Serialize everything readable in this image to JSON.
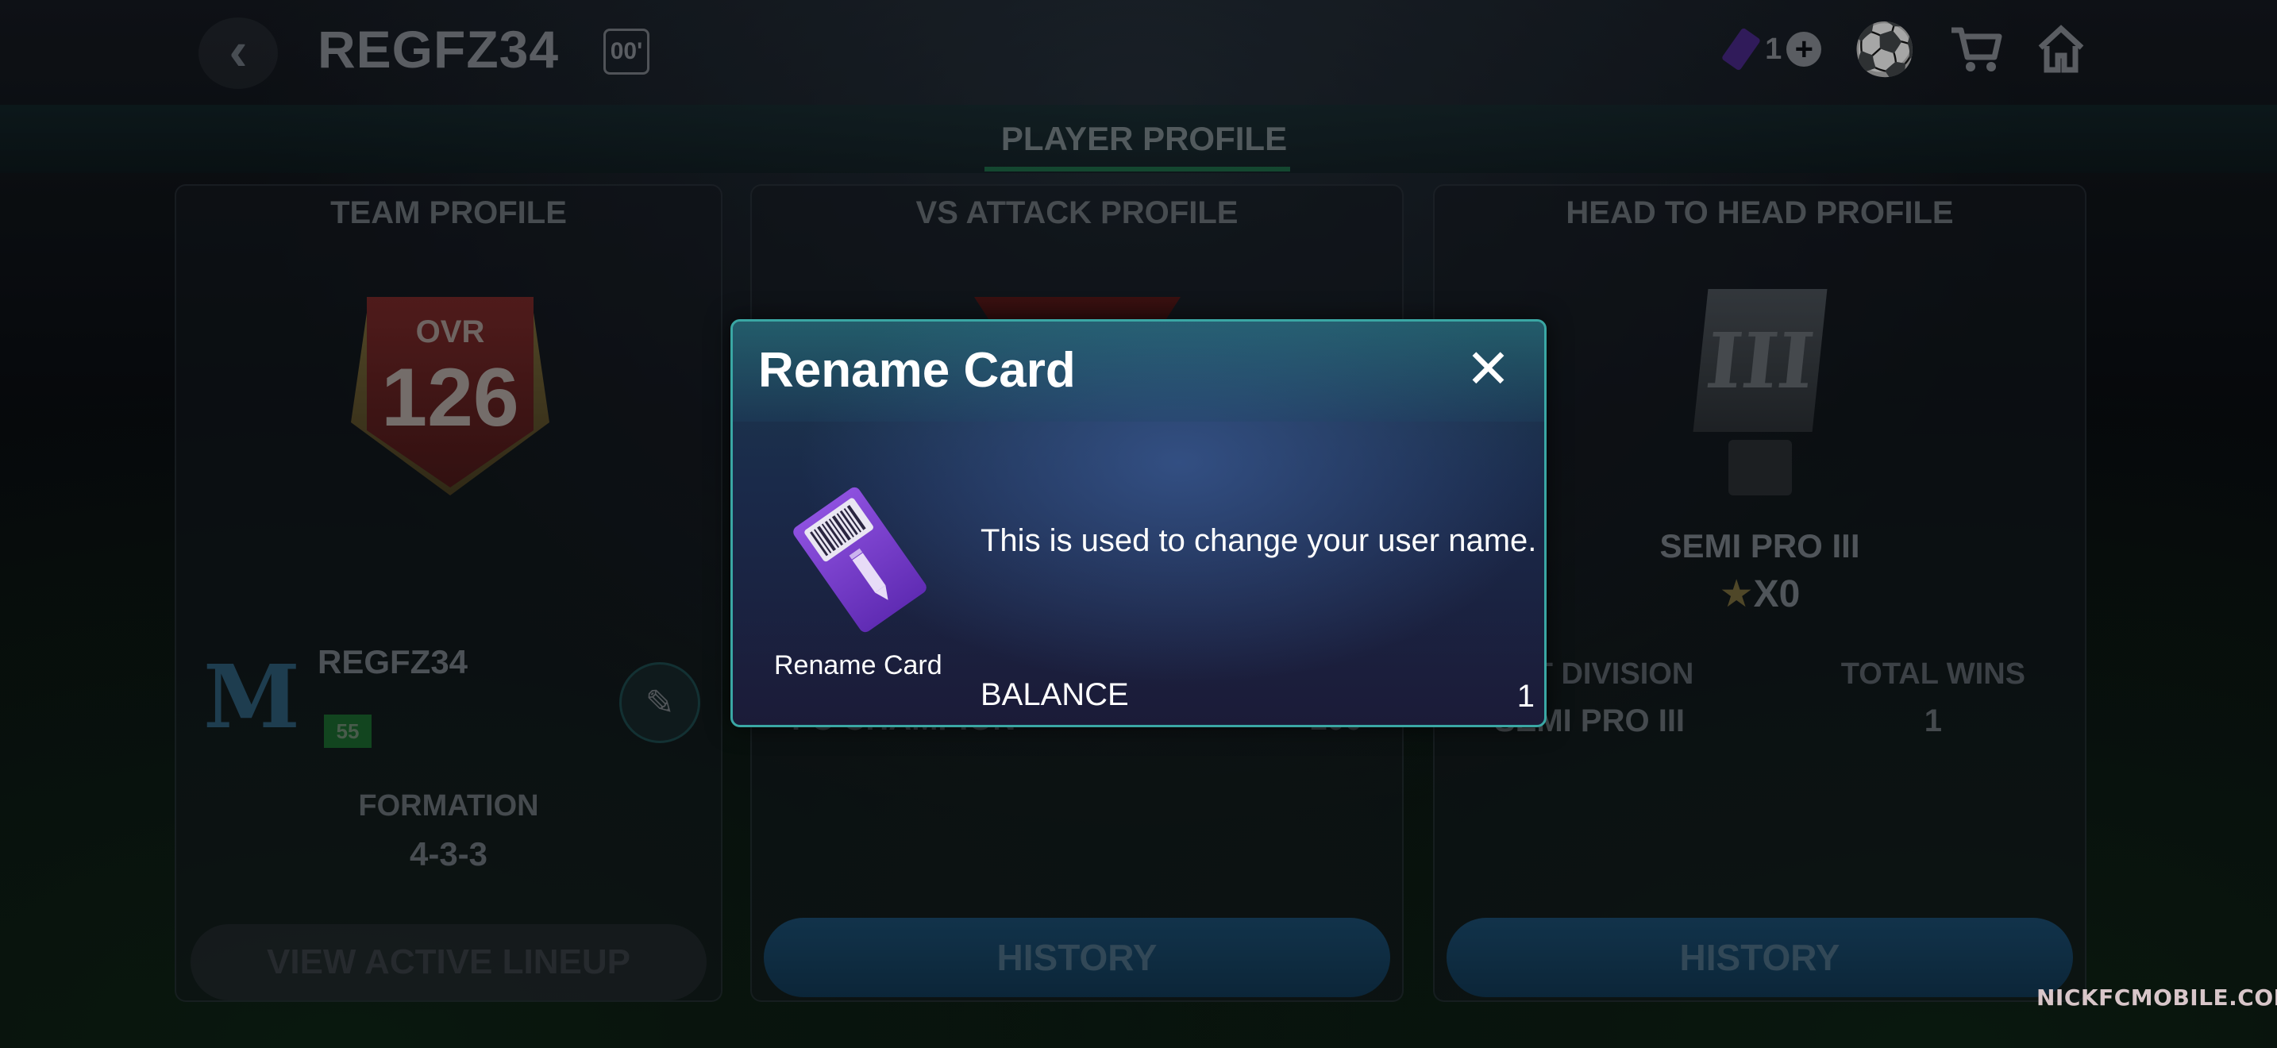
{
  "header": {
    "back_icon": "chevron-left-icon",
    "username": "REGFZ34",
    "level_badge": "00'",
    "rename_card_count": "1",
    "icons": [
      "ticket-icon",
      "plus-icon",
      "ball-icon",
      "cart-icon",
      "home-icon"
    ]
  },
  "tabs": {
    "active": "PLAYER PROFILE"
  },
  "team_profile": {
    "title": "TEAM PROFILE",
    "ovr_label": "OVR",
    "ovr_value": "126",
    "team_name": "REGFZ34",
    "team_level": "55",
    "formation_label": "FORMATION",
    "formation_value": "4-3-3",
    "lineup_button": "VIEW ACTIVE LINEUP"
  },
  "vs_attack": {
    "title": "VS ATTACK PROFILE",
    "row_label": "FC CHAMPION",
    "row_value": "100",
    "history_button": "HISTORY"
  },
  "h2h": {
    "title": "HEAD TO HEAD PROFILE",
    "trophy_numeral": "III",
    "division": "SEMI PRO III",
    "stars": "X0",
    "best_division_label": "EST DIVISION",
    "total_wins_label": "TOTAL WINS",
    "best_division_value": "SEMI PRO III",
    "total_wins_value": "1",
    "history_button": "HISTORY"
  },
  "modal": {
    "title": "Rename Card",
    "close_icon": "close-icon",
    "item_label": "Rename Card",
    "description": "This is used to change your user name.",
    "balance_label": "BALANCE",
    "balance_value": "1"
  },
  "watermark": "NICKFCMOBILE.COM",
  "colors": {
    "modal_border": "#3aa7a4",
    "ticket_purple": "#7b3fd1",
    "history_blue": "#1c4f73"
  }
}
